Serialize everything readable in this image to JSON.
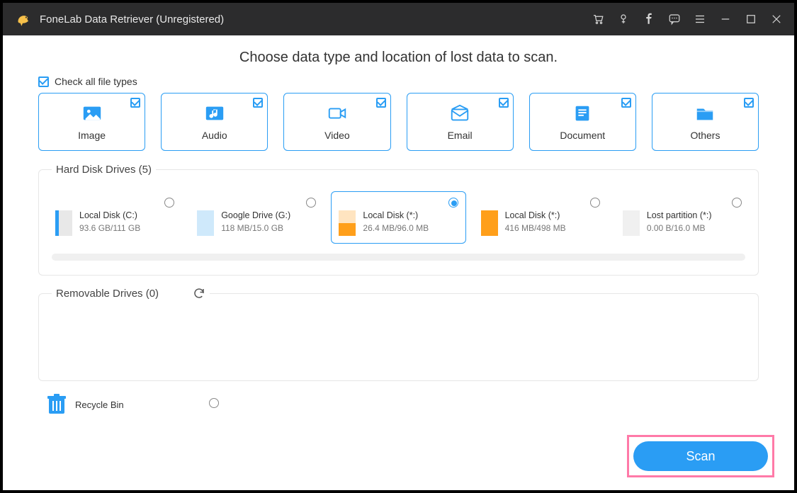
{
  "titlebar": {
    "title": "FoneLab Data Retriever (Unregistered)"
  },
  "headline": "Choose data type and location of lost data to scan.",
  "check_all_label": "Check all file types",
  "types": [
    {
      "label": "Image"
    },
    {
      "label": "Audio"
    },
    {
      "label": "Video"
    },
    {
      "label": "Email"
    },
    {
      "label": "Document"
    },
    {
      "label": "Others"
    }
  ],
  "hard_drives": {
    "legend": "Hard Disk Drives (5)",
    "items": [
      {
        "name": "Local Disk (C:)",
        "size": "93.6 GB/111 GB",
        "swatch": "sw-blue-thin",
        "selected": false
      },
      {
        "name": "Google Drive (G:)",
        "size": "118 MB/15.0 GB",
        "swatch": "sw-lightblue",
        "selected": false
      },
      {
        "name": "Local Disk (*:)",
        "size": "26.4 MB/96.0 MB",
        "swatch": "sw-orange1",
        "selected": true
      },
      {
        "name": "Local Disk (*:)",
        "size": "416 MB/498 MB",
        "swatch": "sw-orange2",
        "selected": false
      },
      {
        "name": "Lost partition (*:)",
        "size": "0.00  B/16.0 MB",
        "swatch": "sw-gray",
        "selected": false
      }
    ]
  },
  "removable": {
    "legend": "Removable Drives (0)"
  },
  "recycle_bin": {
    "label": "Recycle Bin"
  },
  "scan_label": "Scan"
}
